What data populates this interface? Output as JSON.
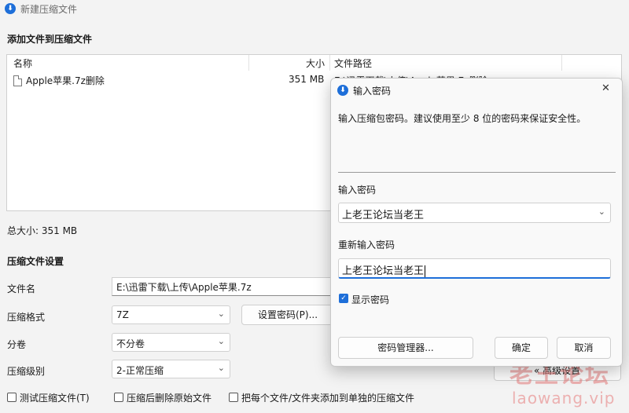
{
  "window": {
    "app_icon_glyph": "⬇",
    "title": "新建压缩文件"
  },
  "add_files": {
    "section_title": "添加文件到压缩文件",
    "columns": {
      "name": "名称",
      "size": "大小",
      "path": "文件路径"
    },
    "files": [
      {
        "name": "Apple苹果.7z删除",
        "size": "351 MB",
        "path": "E:\\迅雷下载\\上传\\Apple苹果.7z删除"
      }
    ],
    "total_size": "总大小: 351 MB"
  },
  "settings": {
    "section_title": "压缩文件设置",
    "filename_label": "文件名",
    "filename_value": "E:\\迅雷下载\\上传\\Apple苹果.7z",
    "format_label": "压缩格式",
    "format_value": "7Z",
    "set_password_button": "设置密码(P)...",
    "split_label": "分卷",
    "split_value": "不分卷",
    "level_label": "压缩级别",
    "level_value": "2-正常压缩",
    "opt_test": "测试压缩文件(T)",
    "opt_delete": "压缩后删除原始文件",
    "opt_separate": "把每个文件/文件夹添加到单独的压缩文件",
    "partial_button": "« 高级设置"
  },
  "dialog": {
    "icon_glyph": "⬇",
    "title": "输入密码",
    "close_glyph": "✕",
    "description": "输入压缩包密码。建议使用至少 8 位的密码来保证安全性。",
    "password_label": "输入密码",
    "password_value": "上老王论坛当老王",
    "confirm_label": "重新输入密码",
    "confirm_value": "上老王论坛当老王",
    "show_password_label": "显示密码",
    "show_password_checked": true,
    "manager_button": "密码管理器...",
    "ok_button": "确定",
    "cancel_button": "取消"
  },
  "watermark": {
    "line1": "老王论坛",
    "line2": "laowang.vip"
  }
}
